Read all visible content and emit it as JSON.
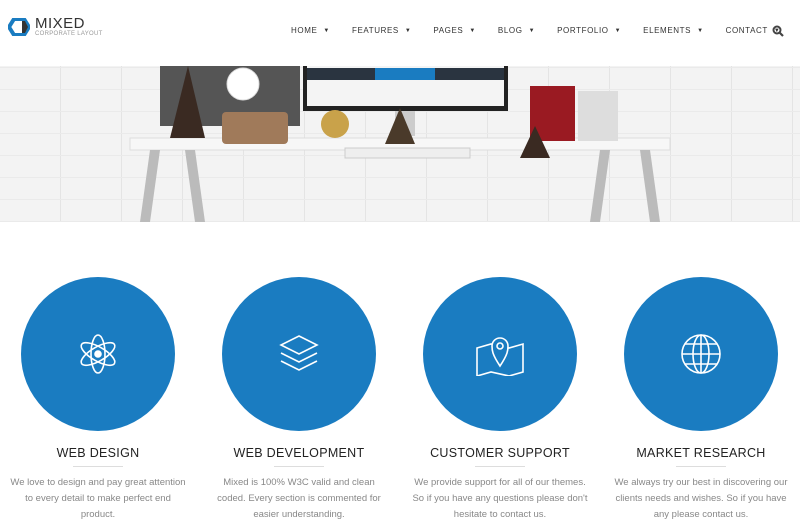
{
  "brand": {
    "name": "MIXED",
    "tagline": "CORPORATE LAYOUT",
    "accent": "#1a7cc1"
  },
  "nav": {
    "items": [
      {
        "label": "HOME"
      },
      {
        "label": "FEATURES"
      },
      {
        "label": "PAGES"
      },
      {
        "label": "BLOG"
      },
      {
        "label": "PORTFOLIO"
      },
      {
        "label": "ELEMENTS"
      },
      {
        "label": "CONTACT"
      }
    ],
    "search_icon": "search-icon"
  },
  "features": [
    {
      "icon": "atom-icon",
      "title": "WEB DESIGN",
      "text": "We love to design and pay great attention to every detail to make perfect end product."
    },
    {
      "icon": "layers-icon",
      "title": "WEB DEVELOPMENT",
      "text": "Mixed is 100% W3C valid and clean coded. Every section is commented for easier understanding."
    },
    {
      "icon": "map-pin-icon",
      "title": "CUSTOMER SUPPORT",
      "text": "We provide support for all of our themes. So if you have any questions please don't hesitate to contact us."
    },
    {
      "icon": "globe-icon",
      "title": "MARKET RESEARCH",
      "text": "We always try our best in discovering our clients needs and wishes. So if you have any please contact us."
    }
  ]
}
